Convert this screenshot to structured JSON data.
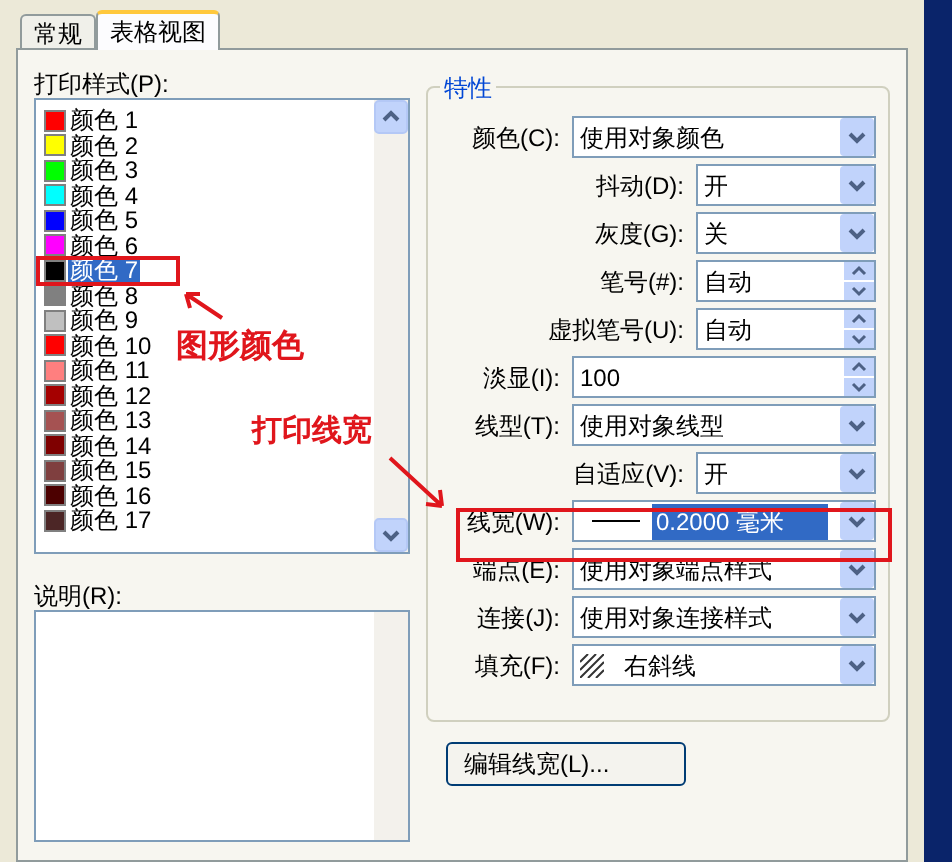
{
  "tabs": [
    {
      "label": "常规",
      "selected": false
    },
    {
      "label": "表格视图",
      "selected": true
    }
  ],
  "styles_label": "打印样式(P):",
  "styles": [
    {
      "label": "颜色 1",
      "color": "#ff0000",
      "selected": false
    },
    {
      "label": "颜色 2",
      "color": "#ffff00",
      "selected": false
    },
    {
      "label": "颜色 3",
      "color": "#00ff00",
      "selected": false
    },
    {
      "label": "颜色 4",
      "color": "#00ffff",
      "selected": false
    },
    {
      "label": "颜色 5",
      "color": "#0000ff",
      "selected": false
    },
    {
      "label": "颜色 6",
      "color": "#ff00ff",
      "selected": false
    },
    {
      "label": "颜色 7",
      "color": "#000000",
      "selected": true
    },
    {
      "label": "颜色 8",
      "color": "#808080",
      "selected": false
    },
    {
      "label": "颜色 9",
      "color": "#c0c0c0",
      "selected": false
    },
    {
      "label": "颜色 10",
      "color": "#ff0000",
      "selected": false
    },
    {
      "label": "颜色 11",
      "color": "#ff7f7f",
      "selected": false
    },
    {
      "label": "颜色 12",
      "color": "#a50000",
      "selected": false
    },
    {
      "label": "颜色 13",
      "color": "#a55252",
      "selected": false
    },
    {
      "label": "颜色 14",
      "color": "#7f0000",
      "selected": false
    },
    {
      "label": "颜色 15",
      "color": "#7f3f3f",
      "selected": false
    },
    {
      "label": "颜色 16",
      "color": "#4c0000",
      "selected": false
    },
    {
      "label": "颜色 17",
      "color": "#4c2626",
      "selected": false
    }
  ],
  "description_label": "说明(R):",
  "properties": {
    "title": "特性",
    "rows": [
      {
        "label": "颜色(C):",
        "value": "使用对象颜色",
        "kind": "combo",
        "short": false
      },
      {
        "label": "抖动(D):",
        "value": "开",
        "kind": "combo",
        "short": true
      },
      {
        "label": "灰度(G):",
        "value": "关",
        "kind": "combo",
        "short": true
      },
      {
        "label": "笔号(#):",
        "value": "自动",
        "kind": "spin",
        "short": true
      },
      {
        "label": "虚拟笔号(U):",
        "value": "自动",
        "kind": "spin",
        "short": true
      },
      {
        "label": "淡显(I):",
        "value": "100",
        "kind": "spin",
        "short": false
      },
      {
        "label": "线型(T):",
        "value": "使用对象线型",
        "kind": "combo",
        "short": false
      },
      {
        "label": "自适应(V):",
        "value": "开",
        "kind": "combo",
        "short": true
      },
      {
        "label": "线宽(W):",
        "value": "0.2000 毫米",
        "kind": "lineweight",
        "short": false,
        "selected": true
      },
      {
        "label": "端点(E):",
        "value": "使用对象端点样式",
        "kind": "combo",
        "short": false
      },
      {
        "label": "连接(J):",
        "value": "使用对象连接样式",
        "kind": "combo",
        "short": false
      },
      {
        "label": "填充(F):",
        "value": "右斜线",
        "kind": "fill",
        "short": false
      }
    ]
  },
  "edit_button": "编辑线宽(L)...",
  "annotations": [
    {
      "text": "图形颜色"
    },
    {
      "text": "打印线宽"
    }
  ]
}
